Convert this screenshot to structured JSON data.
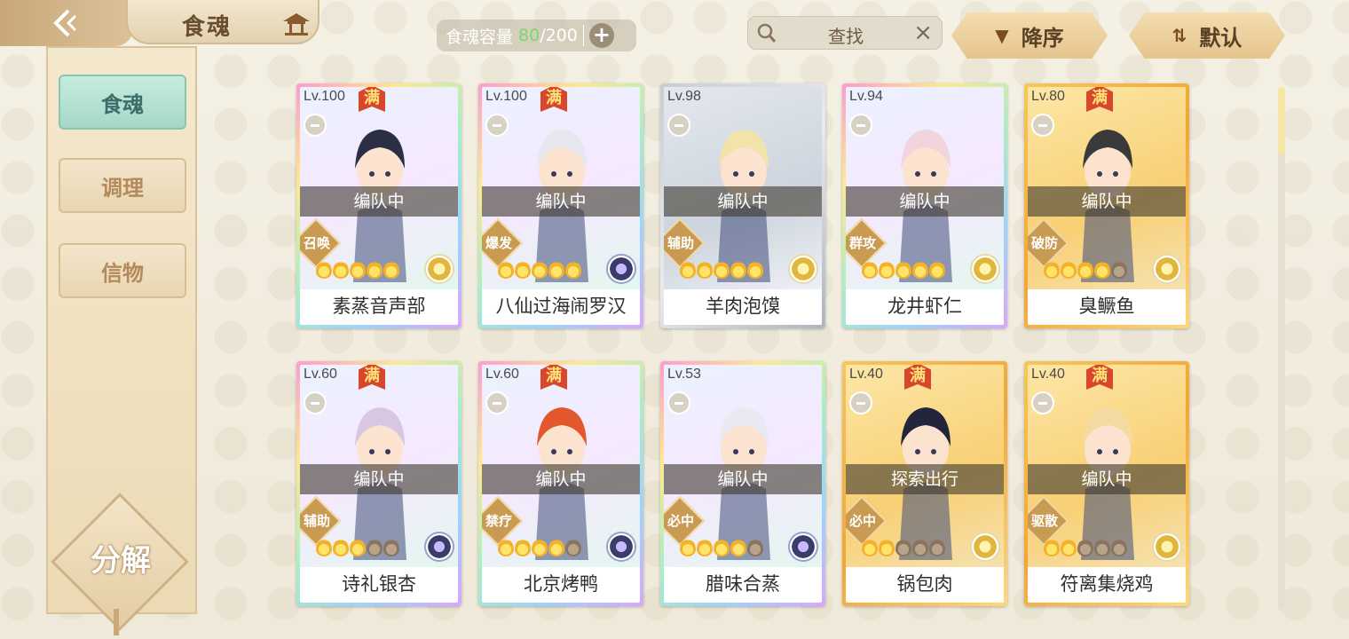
{
  "header": {
    "title": "食魂",
    "capacity_label": "食魂容量",
    "capacity_current": "80",
    "capacity_max": "200",
    "search_placeholder": "查找",
    "sort_order": "降序",
    "sort_mode": "默认"
  },
  "sidebar": {
    "items": [
      {
        "label": "食魂",
        "active": true
      },
      {
        "label": "调理",
        "active": false
      },
      {
        "label": "信物",
        "active": false
      }
    ],
    "decompose_label": "分解"
  },
  "cards": [
    {
      "level": "Lv.100",
      "max": "满",
      "status": "编队中",
      "role": "召唤",
      "stars": 5,
      "name": "素蒸音声部",
      "frame": "rainbow",
      "element": "gold"
    },
    {
      "level": "Lv.100",
      "max": "满",
      "status": "编队中",
      "role": "爆发",
      "stars": 5,
      "name": "八仙过海闹罗汉",
      "frame": "rainbow",
      "element": "dark"
    },
    {
      "level": "Lv.98",
      "max": "",
      "status": "编队中",
      "role": "辅助",
      "stars": 5,
      "name": "羊肉泡馍",
      "frame": "silver",
      "element": "gold"
    },
    {
      "level": "Lv.94",
      "max": "",
      "status": "编队中",
      "role": "群攻",
      "stars": 5,
      "name": "龙井虾仁",
      "frame": "rainbow",
      "element": "gold"
    },
    {
      "level": "Lv.80",
      "max": "满",
      "status": "编队中",
      "role": "破防",
      "stars": 4,
      "name": "臭鳜鱼",
      "frame": "gold",
      "element": "gold"
    },
    {
      "level": "Lv.60",
      "max": "满",
      "status": "编队中",
      "role": "辅助",
      "stars": 3,
      "name": "诗礼银杏",
      "frame": "rainbow",
      "element": "dark"
    },
    {
      "level": "Lv.60",
      "max": "满",
      "status": "编队中",
      "role": "禁疗",
      "stars": 4,
      "name": "北京烤鸭",
      "frame": "rainbow",
      "element": "dark"
    },
    {
      "level": "Lv.53",
      "max": "",
      "status": "编队中",
      "role": "必中",
      "stars": 4,
      "name": "腊味合蒸",
      "frame": "rainbow",
      "element": "dark"
    },
    {
      "level": "Lv.40",
      "max": "满",
      "status": "探索出行",
      "role": "必中",
      "stars": 2,
      "name": "锅包肉",
      "frame": "gold",
      "element": "gold"
    },
    {
      "level": "Lv.40",
      "max": "满",
      "status": "编队中",
      "role": "驱散",
      "stars": 2,
      "name": "符离集烧鸡",
      "frame": "gold",
      "element": "gold"
    }
  ],
  "icons": {
    "back": "back-arrow-icon",
    "title": "pavilion-icon",
    "add": "plus-icon",
    "search": "search-icon",
    "clear": "close-icon",
    "sort_order": "triangle-down-icon",
    "sort_mode": "sort-arrows-icon"
  },
  "colors": {
    "accent_gold": "#e6c48d",
    "active_tab": "#a4d8c8",
    "capacity_current": "#7ed56a",
    "max_badge": "#d8462b"
  }
}
